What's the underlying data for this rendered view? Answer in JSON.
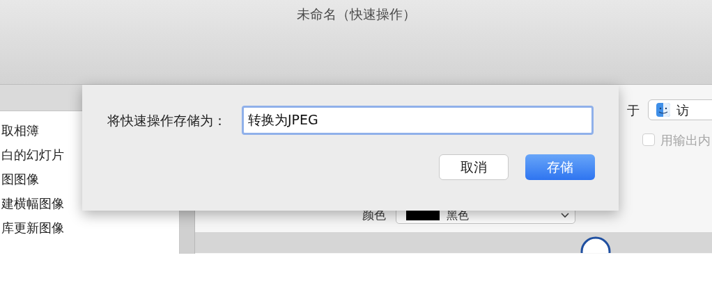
{
  "window": {
    "title": "未命名（快速操作）"
  },
  "actions_list": {
    "items": [
      "取相簿",
      "白的幻灯片",
      "图图像",
      "建横幅图像",
      "库更新图像"
    ]
  },
  "workflow": {
    "input_label": "于",
    "input_app": "访",
    "output_checkbox": {
      "label": "用输出内",
      "checked": false
    },
    "color": {
      "label": "颜色",
      "value": "黑色"
    }
  },
  "dialog": {
    "label": "将快速操作存储为：",
    "name_field": {
      "value": "转换为JPEG"
    },
    "buttons": [
      {
        "label": "取消",
        "primary": false
      },
      {
        "label": "存储",
        "primary": true
      }
    ]
  }
}
